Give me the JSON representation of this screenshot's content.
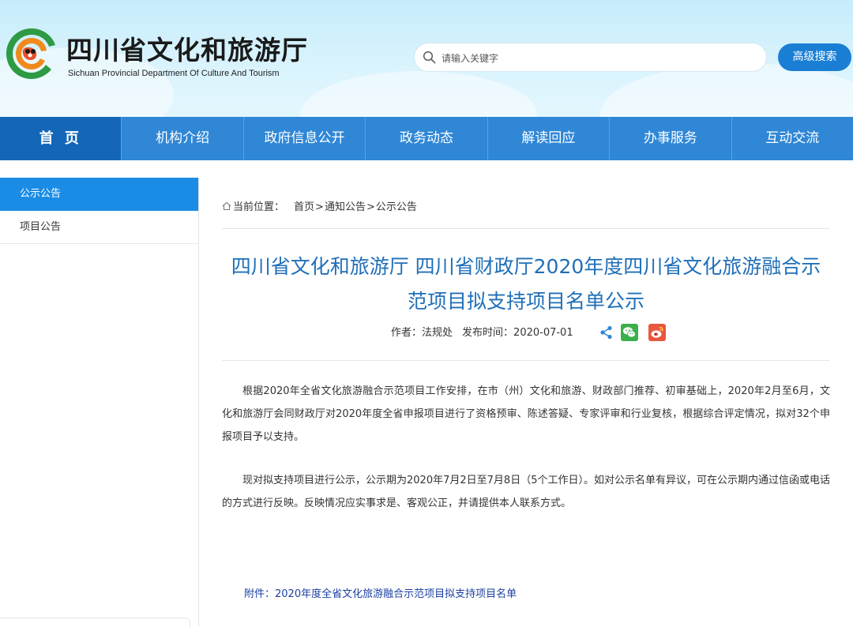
{
  "header": {
    "site_title": "四川省文化和旅游厅",
    "site_subtitle": "Sichuan Provincial Department Of Culture And Tourism",
    "search_placeholder": "请输入关键字",
    "advanced_search_label": "高级搜索"
  },
  "nav": {
    "items": [
      "首 页",
      "机构介绍",
      "政府信息公开",
      "政务动态",
      "解读回应",
      "办事服务",
      "互动交流"
    ],
    "active_index": 0
  },
  "sidebar": {
    "items": [
      "公示公告",
      "项目公告"
    ],
    "active_index": 0
  },
  "breadcrumb": {
    "label": "当前位置：",
    "crumbs": [
      "首页",
      "通知公告",
      "公示公告"
    ],
    "separator": ">"
  },
  "article": {
    "title": "四川省文化和旅游厅 四川省财政厅2020年度四川省文化旅游融合示范项目拟支持项目名单公示",
    "author_label": "作者：",
    "author": "法规处",
    "date_label": "发布时间：",
    "date": "2020-07-01",
    "paragraphs": [
      "根据2020年全省文化旅游融合示范项目工作安排，在市（州）文化和旅游、财政部门推荐、初审基础上，2020年2月至6月，文化和旅游厅会同财政厅对2020年度全省申报项目进行了资格预审、陈述答疑、专家评审和行业复核，根据综合评定情况，拟对32个申报项目予以支持。",
      "现对拟支持项目进行公示，公示期为2020年7月2日至7月8日（5个工作日）。如对公示名单有异议，可在公示期内通过信函或电话的方式进行反映。反映情况应实事求是、客观公正，并请提供本人联系方式。"
    ],
    "attachment_label": "附件：",
    "attachment_link": "2020年度全省文化旅游融合示范项目拟支持项目名单"
  },
  "icons": {
    "logo": "panda-logo-icon",
    "search": "search-icon",
    "home": "home-icon",
    "share": "share-icon",
    "wechat": "wechat-icon",
    "weibo": "weibo-icon"
  },
  "colors": {
    "nav_bg": "#2f87d6",
    "nav_active_bg": "#1467b8",
    "sidebar_active_bg": "#1a8ce6",
    "title_color": "#1f6fb8",
    "attachment_color": "#1a3fa0",
    "search_button_bg": "#1a7fd4"
  }
}
